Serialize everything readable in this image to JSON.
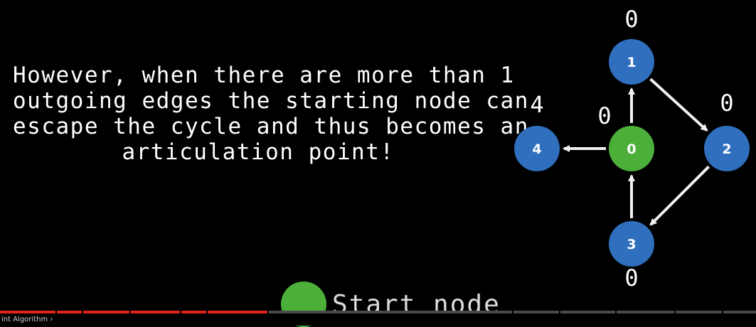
{
  "caption": {
    "line1": "However, when there are more than 1",
    "line2": "outgoing edges the starting node can",
    "line3": "escape the cycle and thus becomes an",
    "line4": "articulation point!"
  },
  "graph": {
    "nodes": [
      {
        "id": "0",
        "label": "0",
        "value": "0",
        "color": "#4caf3a"
      },
      {
        "id": "1",
        "label": "1",
        "value": "0",
        "color": "#2f6fbd"
      },
      {
        "id": "2",
        "label": "2",
        "value": "0",
        "color": "#2f6fbd"
      },
      {
        "id": "3",
        "label": "3",
        "value": "0",
        "color": "#2f6fbd"
      },
      {
        "id": "4",
        "label": "4",
        "value": "4",
        "color": "#2f6fbd"
      }
    ],
    "edges": [
      {
        "from": "0",
        "to": "1"
      },
      {
        "from": "1",
        "to": "2"
      },
      {
        "from": "2",
        "to": "3"
      },
      {
        "from": "3",
        "to": "0"
      },
      {
        "from": "0",
        "to": "4"
      }
    ],
    "edge_color": "#f0f0f0"
  },
  "legend": {
    "label": "Start node",
    "color": "#4caf3a"
  },
  "player": {
    "progress_fraction": 0.355,
    "bottom_text": "int Algorithm ›",
    "progress_color": "#e0241c"
  }
}
